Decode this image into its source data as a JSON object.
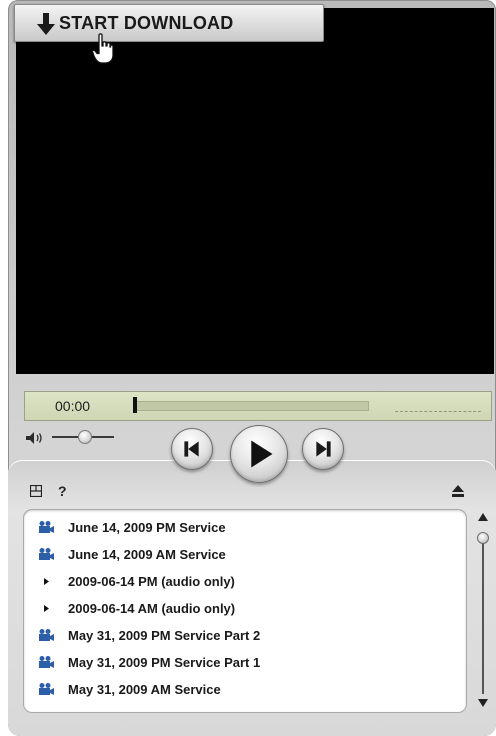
{
  "toolbar": {
    "download_label": "START DOWNLOAD",
    "download_icon": "down-arrow-icon"
  },
  "seek": {
    "time": "00:00",
    "progress": 0
  },
  "volume": {
    "level": 0.45
  },
  "playlist": {
    "items": [
      {
        "label": "June 14, 2009 PM Service",
        "icon": "video-camera-icon"
      },
      {
        "label": "June 14, 2009 AM Service",
        "icon": "video-camera-icon"
      },
      {
        "label": "2009-06-14 PM (audio only)",
        "icon": "triangle-bullet-icon"
      },
      {
        "label": "2009-06-14 AM (audio only)",
        "icon": "triangle-bullet-icon"
      },
      {
        "label": "May 31, 2009 PM Service Part 2",
        "icon": "video-camera-icon"
      },
      {
        "label": "May 31, 2009 PM Service Part 1",
        "icon": "video-camera-icon"
      },
      {
        "label": "May 31, 2009 AM Service",
        "icon": "video-camera-icon"
      }
    ]
  },
  "colors": {
    "seek_bg": "#cfd6b4",
    "video_bg": "#000000",
    "camera_blue": "#2c5fa8"
  }
}
